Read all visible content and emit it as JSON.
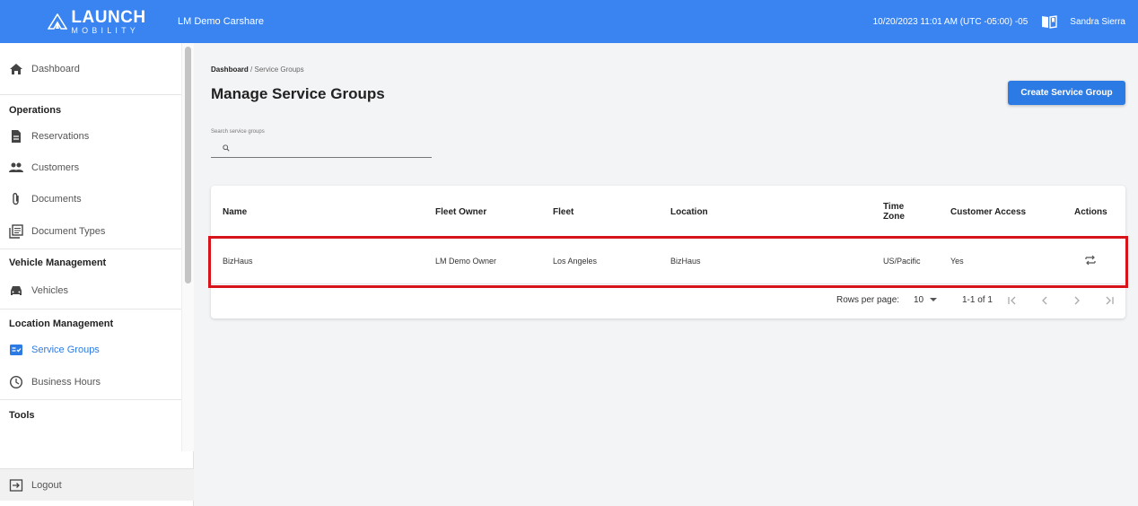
{
  "header": {
    "brand_main": "LAUNCH",
    "brand_sub": "MOBILITY",
    "org_name": "LM Demo Carshare",
    "datetime": "10/20/2023 11:01 AM (UTC -05:00) -05",
    "user_name": "Sandra Sierra",
    "accent_color": "#3a84f1"
  },
  "sidebar": {
    "dashboard": "Dashboard",
    "sections": {
      "operations": "Operations",
      "vehicle_management": "Vehicle Management",
      "location_management": "Location Management",
      "tools": "Tools"
    },
    "items": {
      "reservations": "Reservations",
      "customers": "Customers",
      "documents": "Documents",
      "document_types": "Document Types",
      "vehicles": "Vehicles",
      "service_groups": "Service Groups",
      "business_hours": "Business Hours"
    },
    "logout": "Logout"
  },
  "main": {
    "breadcrumb_root": "Dashboard",
    "breadcrumb_sep": "/",
    "breadcrumb_current": "Service Groups",
    "title": "Manage Service Groups",
    "create_button": "Create Service Group",
    "search_label": "Search service groups",
    "search_value": ""
  },
  "table": {
    "columns": {
      "name": "Name",
      "fleet_owner": "Fleet Owner",
      "fleet": "Fleet",
      "location": "Location",
      "time_zone_1": "Time",
      "time_zone_2": "Zone",
      "customer_access": "Customer Access",
      "actions": "Actions"
    },
    "rows": [
      {
        "name": "BizHaus",
        "fleet_owner": "LM Demo Owner",
        "fleet": "Los Angeles",
        "location": "BizHaus",
        "time_zone": "US/Pacific",
        "customer_access": "Yes"
      }
    ],
    "pagination": {
      "rows_per_page_label": "Rows per page:",
      "rows_per_page": "10",
      "range": "1-1 of 1"
    }
  }
}
